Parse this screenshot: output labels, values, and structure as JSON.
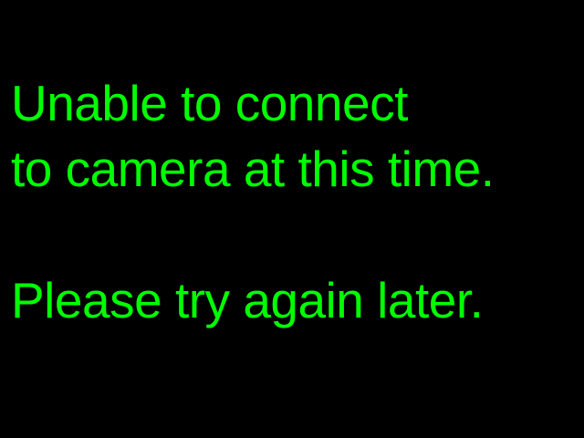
{
  "message": {
    "line1": "Unable to connect",
    "line2": "to camera at this time.",
    "line3": "Please try again later."
  },
  "colors": {
    "background": "#000000",
    "text": "#00ff00"
  }
}
